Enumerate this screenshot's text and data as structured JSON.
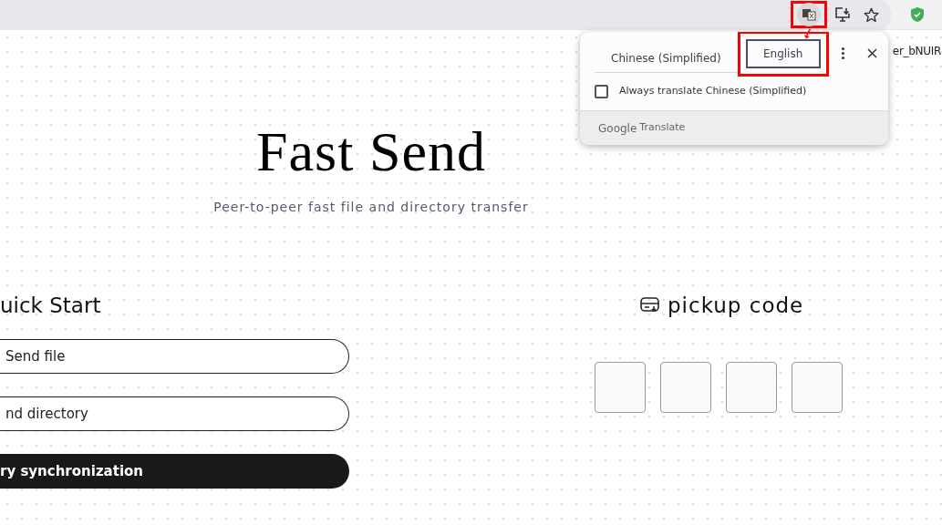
{
  "page": {
    "hidden_text": "er_bNUIR",
    "title": "Fast Send",
    "subtitle": "Peer-to-peer fast file and directory transfer",
    "quick_start": {
      "heading": "uick Start",
      "buttons": [
        {
          "label": "Send file",
          "kind": "outline"
        },
        {
          "label": "nd directory",
          "kind": "outline"
        },
        {
          "label": "ry synchronization",
          "kind": "filled"
        }
      ]
    },
    "pickup": {
      "heading": "pickup code",
      "boxes": [
        {
          "kind": "empty"
        },
        {
          "kind": "empty"
        },
        {
          "kind": "empty"
        },
        {
          "kind": "empty"
        }
      ]
    }
  },
  "translate_popup": {
    "tabs": [
      {
        "label": "Chinese (Simplified)",
        "selected": true,
        "focused": false
      },
      {
        "label": "English",
        "selected": false,
        "focused": true
      }
    ],
    "always_translate": {
      "label": "Always translate Chinese (Simplified)",
      "checked": false
    },
    "footer": {
      "brand": "Google",
      "product": "Translate"
    }
  }
}
